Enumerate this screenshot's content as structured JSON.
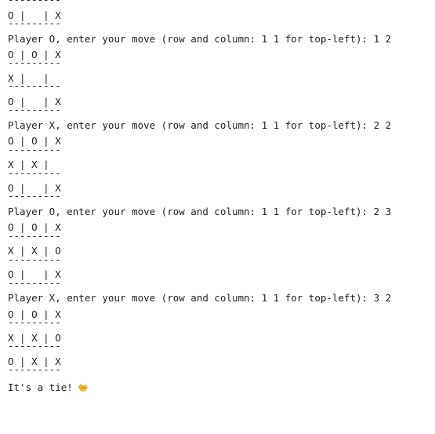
{
  "lines": [
    {
      "kind": "sep",
      "text": "---------"
    },
    {
      "kind": "row",
      "text": "O |   | X"
    },
    {
      "kind": "sep",
      "text": "---------"
    },
    {
      "kind": "prompt",
      "text": "Player O, enter your move (row and column: 1 1 for top-left): 1 2"
    },
    {
      "kind": "row",
      "text": "O | O | X"
    },
    {
      "kind": "sep",
      "text": "---------"
    },
    {
      "kind": "row",
      "text": "X |   |"
    },
    {
      "kind": "sep",
      "text": "---------"
    },
    {
      "kind": "row",
      "text": "O |   | X"
    },
    {
      "kind": "sep",
      "text": "---------"
    },
    {
      "kind": "prompt",
      "text": "Player X, enter your move (row and column: 1 1 for top-left): 2 2"
    },
    {
      "kind": "row",
      "text": "O | O | X"
    },
    {
      "kind": "sep",
      "text": "---------"
    },
    {
      "kind": "row",
      "text": "X | X |"
    },
    {
      "kind": "sep",
      "text": "---------"
    },
    {
      "kind": "row",
      "text": "O |   | X"
    },
    {
      "kind": "sep",
      "text": "---------"
    },
    {
      "kind": "prompt",
      "text": "Player O, enter your move (row and column: 1 1 for top-left): 2 3"
    },
    {
      "kind": "row",
      "text": "O | O | X"
    },
    {
      "kind": "sep",
      "text": "---------"
    },
    {
      "kind": "row",
      "text": "X | X | O"
    },
    {
      "kind": "sep",
      "text": "---------"
    },
    {
      "kind": "row",
      "text": "O |   | X"
    },
    {
      "kind": "sep",
      "text": "---------"
    },
    {
      "kind": "prompt",
      "text": "Player X, enter your move (row and column: 1 1 for top-left): 3 2"
    },
    {
      "kind": "row",
      "text": "O | O | X"
    },
    {
      "kind": "sep",
      "text": "---------"
    },
    {
      "kind": "row",
      "text": "X | X | O"
    },
    {
      "kind": "sep",
      "text": "---------"
    },
    {
      "kind": "row",
      "text": "O | X | X"
    },
    {
      "kind": "sep",
      "text": "---------"
    }
  ],
  "final_message": "It's a tie!",
  "final_emoji_icon": "handshake-icon"
}
